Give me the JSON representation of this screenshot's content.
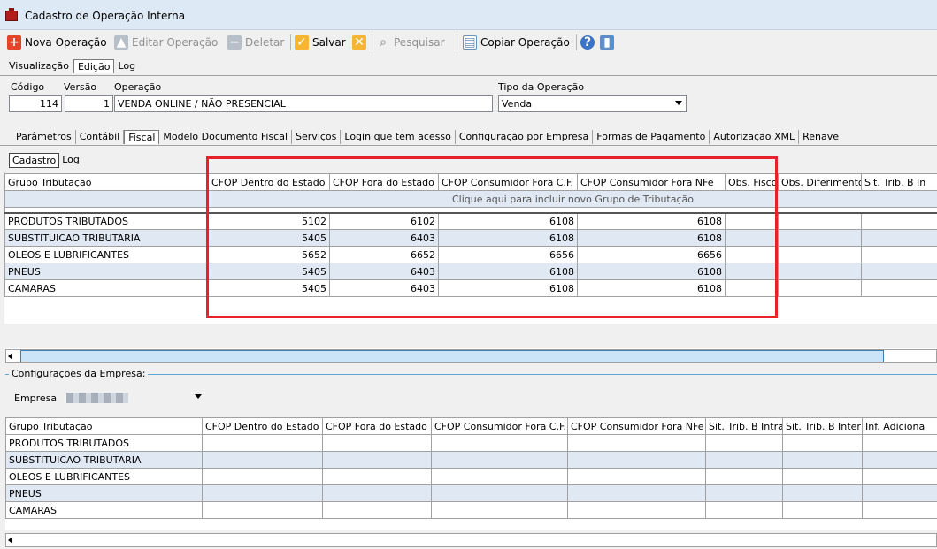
{
  "window": {
    "title": "Cadastro de Operação Interna"
  },
  "toolbar": {
    "nova": "Nova Operação",
    "editar": "Editar Operação",
    "deletar": "Deletar",
    "salvar": "Salvar",
    "pesquisar": "Pesquisar",
    "copiar": "Copiar Operação"
  },
  "main_tabs": [
    "Visualização",
    "Edição",
    "Log"
  ],
  "form": {
    "codigo_label": "Código",
    "codigo": "114",
    "versao_label": "Versão",
    "versao": "1",
    "operacao_label": "Operação",
    "operacao": "VENDA ONLINE / NÃO PRESENCIAL",
    "tipo_label": "Tipo da Operação",
    "tipo": "Venda"
  },
  "section_tabs": [
    "Parâmetros",
    "Contábil",
    "Fiscal",
    "Modelo Documento Fiscal",
    "Serviços",
    "Login que tem acesso",
    "Configuração por Empresa",
    "Formas de Pagamento",
    "Autorização XML",
    "Renave"
  ],
  "sub_tabs": [
    "Cadastro",
    "Log"
  ],
  "grid1": {
    "headers": [
      "Grupo Tributação",
      "CFOP Dentro do Estado",
      "CFOP Fora do Estado",
      "CFOP Consumidor Fora C.F.",
      "CFOP Consumidor Fora NFe",
      "Obs. Fisco",
      "Obs. Diferimento",
      "Sit. Trib. B In"
    ],
    "new_row": "Clique aqui para incluir novo Grupo de Tributação",
    "rows": [
      [
        "PRODUTOS TRIBUTADOS",
        "5102",
        "6102",
        "6108",
        "6108"
      ],
      [
        "SUBSTITUICAO TRIBUTARIA",
        "5405",
        "6403",
        "6108",
        "6108"
      ],
      [
        "OLEOS E LUBRIFICANTES",
        "5652",
        "6652",
        "6656",
        "6656"
      ],
      [
        "PNEUS",
        "5405",
        "6403",
        "6108",
        "6108"
      ],
      [
        "CAMARAS",
        "5405",
        "6403",
        "6108",
        "6108"
      ]
    ]
  },
  "empresa": {
    "group_title": "Configurações da Empresa:",
    "label": "Empresa"
  },
  "grid2": {
    "headers": [
      "Grupo Tributação",
      "CFOP Dentro do Estado",
      "CFOP Fora do Estado",
      "CFOP Consumidor Fora C.F.",
      "CFOP Consumidor Fora NFe",
      "Sit. Trib. B Intra",
      "Sit. Trib. B Inter",
      "Inf. Adiciona"
    ],
    "rows": [
      "PRODUTOS TRIBUTADOS",
      "SUBSTITUICAO TRIBUTARIA",
      "OLEOS E LUBRIFICANTES",
      "PNEUS",
      "CAMARAS"
    ]
  }
}
